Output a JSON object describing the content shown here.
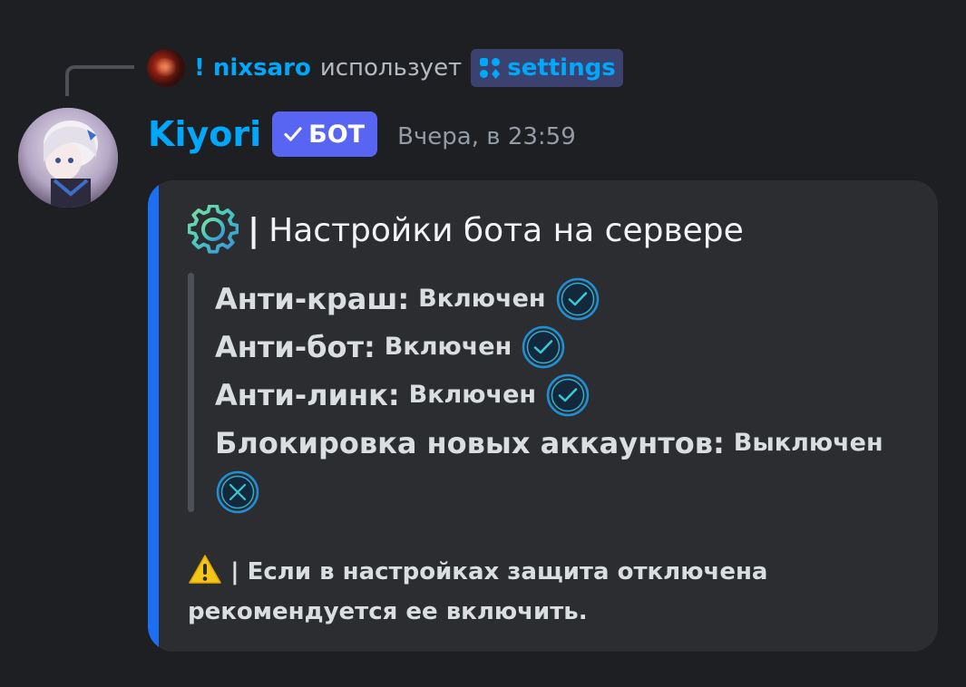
{
  "reply": {
    "username": "! nixsaro",
    "action": "использует",
    "command": "settings"
  },
  "message": {
    "author": "Kiyori",
    "badge": "БОТ",
    "timestamp": "Вчера, в 23:59"
  },
  "embed": {
    "accent_color": "#1c6ef2",
    "title_separator": "|",
    "title": "Настройки бота на сервере",
    "settings": [
      {
        "label": "Анти-краш:",
        "value": "Включен",
        "status": "check-icon"
      },
      {
        "label": "Анти-бот:",
        "value": "Включен",
        "status": "check-icon"
      },
      {
        "label": "Анти-линк:",
        "value": "Включен",
        "status": "check-icon"
      },
      {
        "label": "Блокировка новых аккаунтов:",
        "value": "Выключен",
        "status": "cross-icon"
      }
    ],
    "footer_separator": "|",
    "footer_text_line1": "Если в настройках защита отключена",
    "footer_text_line2": "рекомендуется ее включить."
  },
  "colors": {
    "background": "#1e1f22",
    "embed_background": "#2b2d31",
    "username_blue": "#00a8fc",
    "badge": "#5865f2",
    "timestamp": "#949ba4"
  }
}
